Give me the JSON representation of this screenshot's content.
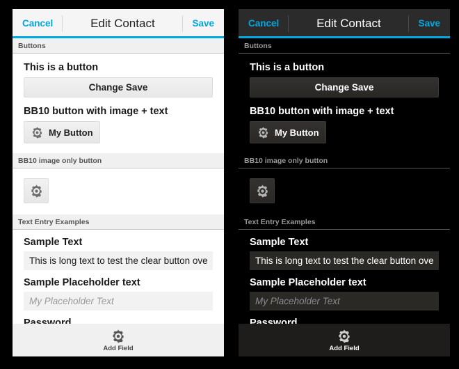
{
  "theme_colors": {
    "accent": "#00a8e0",
    "light_bg": "#ffffff",
    "dark_bg": "#000000",
    "light_titlebar": "#f5f5f5",
    "dark_titlebar": "#2b2b2b",
    "light_input": "#f2f2f2",
    "dark_input": "#2b2926",
    "light_button": "#eeeeee",
    "dark_button": "#2e2c2b"
  },
  "titlebar": {
    "cancel_label": "Cancel",
    "title": "Edit Contact",
    "save_label": "Save"
  },
  "sections": {
    "buttons_header": "Buttons",
    "image_only_header": "BB10 image only button",
    "text_entry_header": "Text Entry Examples"
  },
  "buttons_section": {
    "button_label": "This is a button",
    "change_save_label": "Change Save",
    "image_text_label": "BB10 button with image + text",
    "my_button_label": "My Button",
    "gear_icon": "gear-icon"
  },
  "text_entry_section": {
    "sample_text_label": "Sample Text",
    "sample_text_value": "This is long text to test the clear button ove",
    "placeholder_label": "Sample Placeholder text",
    "placeholder_value": "My Placeholder Text",
    "password_label": "Password"
  },
  "action_bar": {
    "add_field_label": "Add Field",
    "icon": "gear-icon"
  },
  "panels": [
    {
      "name": "light-theme-panel",
      "theme": "light"
    },
    {
      "name": "dark-theme-panel",
      "theme": "dark"
    }
  ]
}
